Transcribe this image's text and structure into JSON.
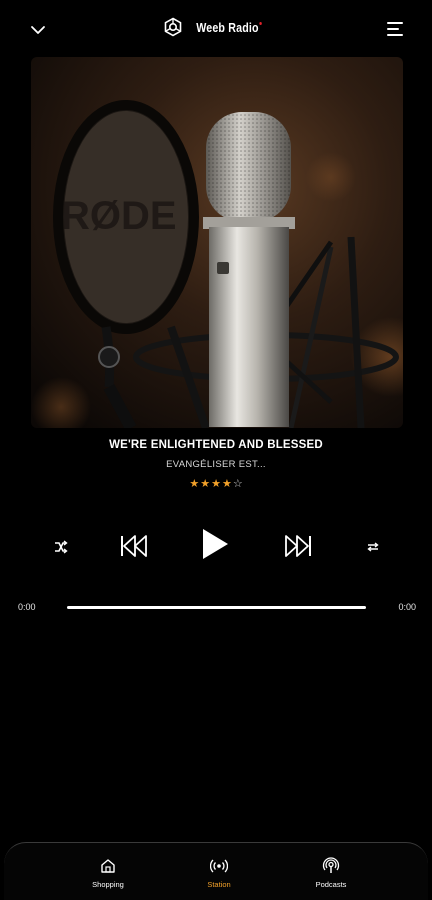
{
  "app": {
    "brand": "Weeb Radio"
  },
  "track": {
    "title": "WE'RE ENLIGHTENED AND BLESSED",
    "artist": "EVANGÉLISER EST...",
    "rating": 4,
    "rating_max": 5
  },
  "player": {
    "current_time": "0:00",
    "duration": "0:00",
    "progress": 0
  },
  "nav": {
    "items": [
      {
        "label": "Shopping",
        "icon": "home-icon",
        "active": false
      },
      {
        "label": "Station",
        "icon": "radio-icon",
        "active": true
      },
      {
        "label": "Podcasts",
        "icon": "podcast-icon",
        "active": false
      }
    ]
  },
  "colors": {
    "accent": "#f2a12a",
    "background": "#000000",
    "brand_dot": "#e0222a"
  }
}
